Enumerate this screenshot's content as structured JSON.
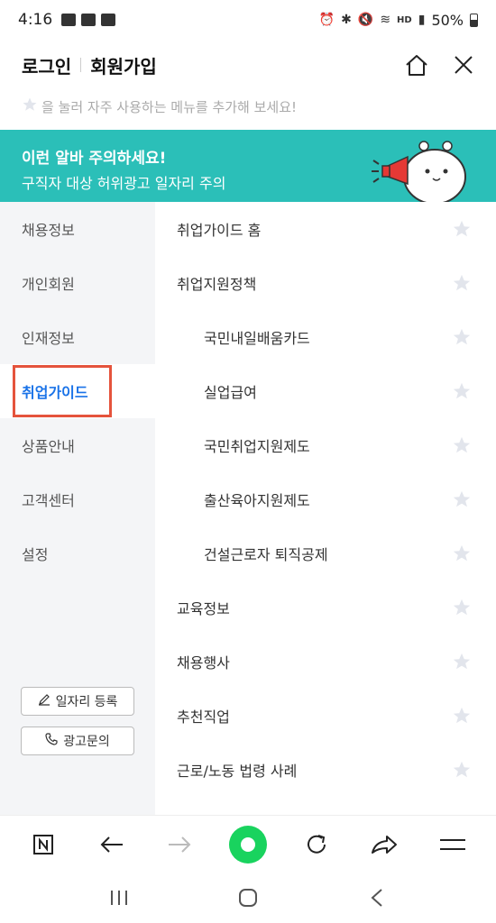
{
  "status_bar": {
    "time": "4:16",
    "battery": "50%",
    "icons": [
      "gallery-icon",
      "app-icon",
      "checkbox-icon",
      "alarm-icon",
      "bluetooth-icon",
      "mute-icon",
      "wifi-icon",
      "hd-voice-icon",
      "signal-icon",
      "battery-icon"
    ]
  },
  "header": {
    "login": "로그인",
    "join": "회원가입",
    "icons": [
      "home-icon",
      "close-icon"
    ]
  },
  "favorite_tip": "을 눌러 자주 사용하는 메뉴를 추가해 보세요!",
  "banner": {
    "title": "이런 알바 주의하세요!",
    "subtitle": "구직자 대상 허위광고 일자리 주의"
  },
  "side_menu": {
    "items": [
      {
        "label": "채용정보",
        "active": false
      },
      {
        "label": "개인회원",
        "active": false
      },
      {
        "label": "인재정보",
        "active": false
      },
      {
        "label": "취업가이드",
        "active": true
      },
      {
        "label": "상품안내",
        "active": false
      },
      {
        "label": "고객센터",
        "active": false
      },
      {
        "label": "설정",
        "active": false
      }
    ],
    "register_button": "일자리 등록",
    "ad_inquiry_button": "광고문의"
  },
  "content_menu": {
    "items": [
      {
        "label": "취업가이드 홈",
        "indent": false
      },
      {
        "label": "취업지원정책",
        "indent": false
      },
      {
        "label": "국민내일배움카드",
        "indent": true
      },
      {
        "label": "실업급여",
        "indent": true
      },
      {
        "label": "국민취업지원제도",
        "indent": true
      },
      {
        "label": "출산육아지원제도",
        "indent": true
      },
      {
        "label": "건설근로자 퇴직공제",
        "indent": true
      },
      {
        "label": "교육정보",
        "indent": false
      },
      {
        "label": "채용행사",
        "indent": false
      },
      {
        "label": "추천직업",
        "indent": false
      },
      {
        "label": "근로/노동 법령 사례",
        "indent": false
      }
    ]
  },
  "toolbar": {
    "icons": [
      "naver-icon",
      "back-arrow-icon",
      "forward-arrow-icon",
      "green-dot-icon",
      "refresh-icon",
      "share-icon",
      "menu-icon"
    ]
  },
  "colors": {
    "banner": "#2bbfb8",
    "active_menu": "#1a73e8",
    "highlight_box": "#e5533c",
    "side_bg": "#f4f5f7",
    "star": "#e2e5ec",
    "green": "#19d35e"
  }
}
